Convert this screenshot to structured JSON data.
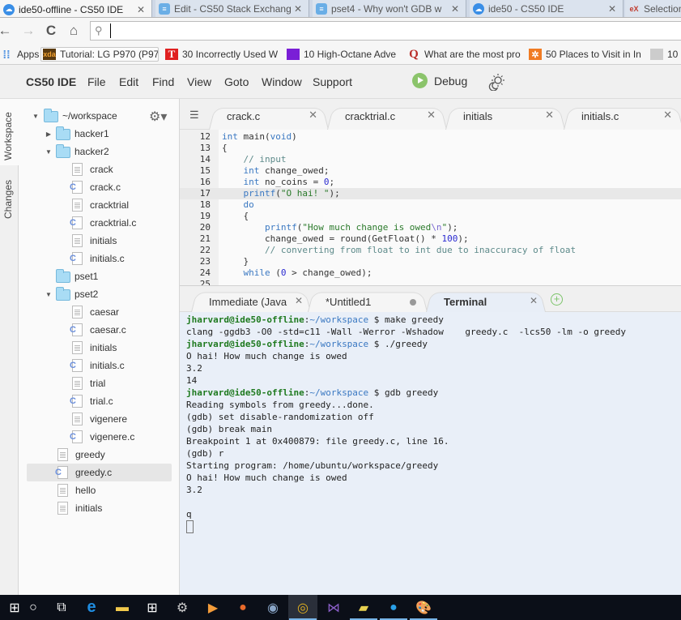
{
  "browser": {
    "tabs": [
      {
        "title": "ide50-offline - CS50 IDE",
        "icon": "cloud9-icon",
        "active": true
      },
      {
        "title": "Edit - CS50 Stack Exchang",
        "icon": "stackexchange-icon",
        "active": false
      },
      {
        "title": "pset4 - Why won't GDB w",
        "icon": "stackexchange-icon",
        "active": false
      },
      {
        "title": "ide50 - CS50 IDE",
        "icon": "cloud9-icon",
        "active": false
      },
      {
        "title": "Selection",
        "icon": "edx-icon",
        "active": false
      }
    ],
    "close_glyph": "✕",
    "nav": {
      "back": "←",
      "forward": "→",
      "reload": "C",
      "home": "⌂"
    },
    "address": {
      "value": "",
      "placeholder": ""
    },
    "bookmarks": [
      {
        "label": "Apps",
        "icon": "apps-grid-icon"
      },
      {
        "label": "Tutorial: LG P970 (P97",
        "icon": "xda-icon",
        "badge": "xda"
      },
      {
        "label": "30 Incorrectly Used W",
        "icon": "t-logo-icon",
        "badge": "T"
      },
      {
        "label": "10 High-Octane Adve",
        "icon": "purple-flag-icon",
        "badge": ""
      },
      {
        "label": "What are the most pro",
        "icon": "quora-icon",
        "badge": "Q"
      },
      {
        "label": "50 Places to Visit in In",
        "icon": "orange-logo-icon",
        "badge": "✲"
      },
      {
        "label": "10",
        "icon": "site-icon",
        "badge": ""
      }
    ]
  },
  "ide": {
    "brand": "CS50 IDE",
    "menu": [
      "File",
      "Edit",
      "Find",
      "View",
      "Goto",
      "Window",
      "Support"
    ],
    "debug_label": "Debug",
    "side_tabs": [
      "Workspace",
      "Changes"
    ],
    "tree": {
      "root": "~/workspace",
      "items": [
        {
          "label": "hacker1",
          "type": "folder",
          "depth": 1,
          "expanded": false
        },
        {
          "label": "hacker2",
          "type": "folder",
          "depth": 1,
          "expanded": true
        },
        {
          "label": "crack",
          "type": "file",
          "depth": 2
        },
        {
          "label": "crack.c",
          "type": "c",
          "depth": 2
        },
        {
          "label": "cracktrial",
          "type": "file",
          "depth": 2
        },
        {
          "label": "cracktrial.c",
          "type": "c",
          "depth": 2
        },
        {
          "label": "initials",
          "type": "file",
          "depth": 2
        },
        {
          "label": "initials.c",
          "type": "c",
          "depth": 2
        },
        {
          "label": "pset1",
          "type": "folder",
          "depth": 1,
          "expanded": null
        },
        {
          "label": "pset2",
          "type": "folder",
          "depth": 1,
          "expanded": true
        },
        {
          "label": "caesar",
          "type": "file",
          "depth": 2
        },
        {
          "label": "caesar.c",
          "type": "c",
          "depth": 2
        },
        {
          "label": "initials",
          "type": "file",
          "depth": 2
        },
        {
          "label": "initials.c",
          "type": "c",
          "depth": 2
        },
        {
          "label": "trial",
          "type": "file",
          "depth": 2
        },
        {
          "label": "trial.c",
          "type": "c",
          "depth": 2
        },
        {
          "label": "vigenere",
          "type": "file",
          "depth": 2
        },
        {
          "label": "vigenere.c",
          "type": "c",
          "depth": 2
        },
        {
          "label": "greedy",
          "type": "file",
          "depth": 1
        },
        {
          "label": "greedy.c",
          "type": "c",
          "depth": 1,
          "selected": true
        },
        {
          "label": "hello",
          "type": "file",
          "depth": 1
        },
        {
          "label": "initials",
          "type": "file",
          "depth": 1
        }
      ]
    },
    "editor_tabs": [
      {
        "label": "crack.c"
      },
      {
        "label": "cracktrial.c"
      },
      {
        "label": "initials"
      },
      {
        "label": "initials.c"
      }
    ],
    "code": {
      "current_line": 17,
      "lines": [
        {
          "n": "12",
          "html": "<span class=\"kw\">int</span> main(<span class=\"kw\">void</span>)"
        },
        {
          "n": "13",
          "html": "{"
        },
        {
          "n": "14",
          "html": "    <span class=\"cmt\">// input</span>"
        },
        {
          "n": "15",
          "html": "    <span class=\"kw\">int</span> change_owed;"
        },
        {
          "n": "16",
          "html": "    <span class=\"kw\">int</span> no_coins = <span class=\"num\">0</span>;"
        },
        {
          "n": "17",
          "html": "    <span class=\"kw\">printf</span>(<span class=\"str\">\"O hai! \"</span>);"
        },
        {
          "n": "18",
          "html": "    <span class=\"kw\">do</span>"
        },
        {
          "n": "19",
          "html": "    {"
        },
        {
          "n": "20",
          "html": "        <span class=\"kw\">printf</span>(<span class=\"str\">\"How much change is owed</span><span class=\"esc\">\\n</span><span class=\"str\">\"</span>);"
        },
        {
          "n": "21",
          "html": "        change_owed = round(GetFloat() * <span class=\"num\">100</span>);"
        },
        {
          "n": "22",
          "html": "        <span class=\"cmt\">// converting from float to int due to inaccuracy of float</span>"
        },
        {
          "n": "23",
          "html": "    }"
        },
        {
          "n": "24",
          "html": "    <span class=\"kw\">while</span> (<span class=\"num\">0</span> &gt; change_owed);"
        },
        {
          "n": "25",
          "html": ""
        }
      ]
    },
    "panel_tabs": [
      {
        "label": "Immediate (Java",
        "state": "close"
      },
      {
        "label": "*Untitled1",
        "state": "modified"
      },
      {
        "label": "Terminal",
        "state": "close",
        "active": true
      }
    ],
    "terminal": {
      "user": "jharvard@ide50-offline",
      "path": "~/workspace",
      "lines": [
        {
          "prompt": true,
          "cmd": "make greedy"
        },
        {
          "text": "clang -ggdb3 -O0 -std=c11 -Wall -Werror -Wshadow    greedy.c  -lcs50 -lm -o greedy"
        },
        {
          "prompt": true,
          "cmd": "./greedy"
        },
        {
          "text": "O hai! How much change is owed"
        },
        {
          "text": "3.2"
        },
        {
          "text": "14"
        },
        {
          "prompt": true,
          "cmd": "gdb greedy"
        },
        {
          "text": "Reading symbols from greedy...done."
        },
        {
          "text": "(gdb) set disable-randomization off"
        },
        {
          "text": "(gdb) break main"
        },
        {
          "text": "Breakpoint 1 at 0x400879: file greedy.c, line 16."
        },
        {
          "text": "(gdb) r"
        },
        {
          "text": "Starting program: /home/ubuntu/workspace/greedy"
        },
        {
          "text": "O hai! How much change is owed"
        },
        {
          "text": "3.2"
        },
        {
          "text": ""
        },
        {
          "text": "q"
        }
      ]
    }
  },
  "taskbar": {
    "items": [
      {
        "name": "start-button",
        "icon": "windows-logo-icon"
      },
      {
        "name": "search-button",
        "icon": "cortana-circle-icon"
      },
      {
        "name": "task-view-button",
        "icon": "task-view-icon"
      },
      {
        "name": "edge-button",
        "icon": "edge-icon"
      },
      {
        "name": "file-explorer-button",
        "icon": "folder-icon"
      },
      {
        "name": "store-button",
        "icon": "store-bag-icon"
      },
      {
        "name": "settings-app-button",
        "icon": "gear-monitor-icon"
      },
      {
        "name": "media-player-button",
        "icon": "media-play-icon"
      },
      {
        "name": "firefox-button",
        "icon": "firefox-icon"
      },
      {
        "name": "safari-button",
        "icon": "compass-icon"
      },
      {
        "name": "chrome-button",
        "icon": "chrome-icon",
        "active": true
      },
      {
        "name": "visual-studio-button",
        "icon": "visual-studio-icon"
      },
      {
        "name": "sticky-notes-button",
        "icon": "sticky-notes-icon",
        "running": true
      },
      {
        "name": "messenger-button",
        "icon": "messenger-icon",
        "running": true
      },
      {
        "name": "paint-button",
        "icon": "paint-palette-icon",
        "running": true
      }
    ]
  },
  "colors": {
    "prompt_user": "#1f7a1f",
    "prompt_path": "#3a78c2",
    "terminal_bg": "#e9eff8",
    "debug_green": "#8bc46b",
    "folder_fill": "#a9dcf5",
    "c_file_badge": "#6b8fdc"
  }
}
